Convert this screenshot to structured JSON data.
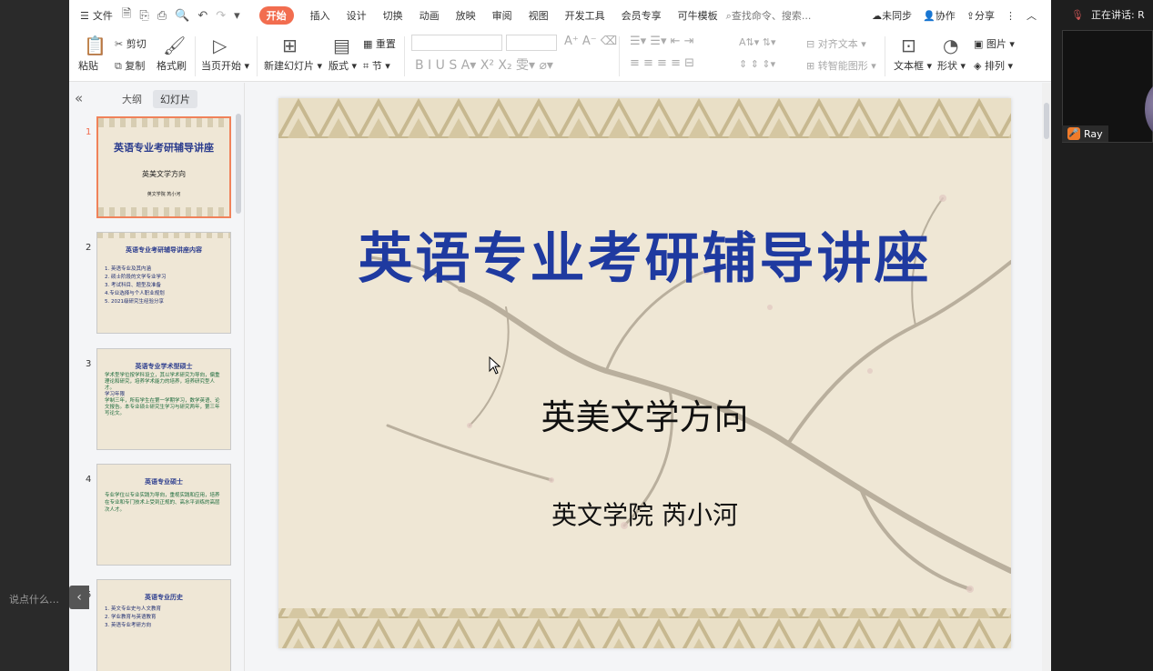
{
  "left": {
    "chat_placeholder": "说点什么…",
    "collapse_icon": "chevron-left-icon"
  },
  "menubar": {
    "file_label": "文件",
    "tabs": [
      "开始",
      "插入",
      "设计",
      "切换",
      "动画",
      "放映",
      "审阅",
      "视图",
      "开发工具",
      "会员专享",
      "可牛模板"
    ],
    "active_tab": "开始",
    "search_label": "查找命令、搜索...",
    "sync_label": "未同步",
    "collab_label": "协作",
    "share_label": "分享"
  },
  "ribbon": {
    "paste": "粘贴",
    "cut": "剪切",
    "copy": "复制",
    "format_painter": "格式刷",
    "from_current": "当页开始",
    "new_slide": "新建幻灯片",
    "layout": "版式",
    "reset": "重置",
    "section": "节",
    "align_text": "对齐文本",
    "smart_art": "转智能图形",
    "textbox": "文本框",
    "shape": "形状",
    "picture": "图片",
    "arrange": "排列"
  },
  "panel": {
    "tab_outline": "大纲",
    "tab_slides": "幻灯片",
    "slides": [
      {
        "num": "1",
        "title": "英语专业考研辅导讲座",
        "sub": "英美文学方向",
        "author": "英文学院 芮小河"
      },
      {
        "num": "2",
        "title": "英语专业考研辅导讲座内容",
        "lines": [
          "1. 英语专业及其内涵",
          "2. 硕士阶段的文学专业学习",
          "3. 考试科目、题型及准备",
          "4.专业选择与个人职业规划",
          "5. 2021级研究生经验分享"
        ]
      },
      {
        "num": "3",
        "title": "英语专业学术型硕士",
        "lines": [
          "学术型学位按学科设立，其以学术研究为导向，偏重理论和研究，培养学术能力的培养，培养研究型人才。",
          "学习年限",
          "学制三年，所有学生在第一学期学习，数学英语、论文报告。本专业硕士研究生学习与研究两年，第三年写论文。"
        ]
      },
      {
        "num": "4",
        "title": "英语专业硕士",
        "lines": [
          "专业学位以专业实践为导向，重视实践和应用，培养在专业和专门技术上受到正规的、高水平训练的高层次人才。"
        ]
      },
      {
        "num": "5",
        "title": "英语专业历史",
        "lines": [
          "1. 英文专业史与人文教育",
          "2. 学业教育与英语教育",
          "3. 英语专业考研方向"
        ]
      }
    ]
  },
  "slide": {
    "title": "英语专业考研辅导讲座",
    "subtitle": "英美文学方向",
    "author": "英文学院 芮小河"
  },
  "meeting": {
    "speaking_label": "正在讲话: R",
    "participant": "Ray"
  },
  "colors": {
    "accent": "#f26d4f",
    "slide_title": "#1f3aa0",
    "slide_bg": "#efe7d5"
  }
}
